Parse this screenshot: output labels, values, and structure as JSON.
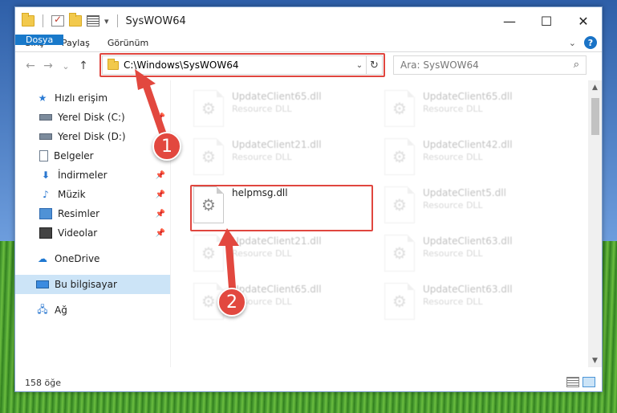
{
  "window": {
    "title": "SysWOW64",
    "controls": {
      "minimize": "—",
      "maximize": "☐",
      "close": "✕"
    }
  },
  "ribbon": {
    "tabs": [
      {
        "label": "Dosya",
        "active": true
      },
      {
        "label": "Giriş"
      },
      {
        "label": "Paylaş"
      },
      {
        "label": "Görünüm"
      }
    ],
    "expand_icon": "chevron-down-icon",
    "help_label": "?"
  },
  "nav_buttons": {
    "back": "←",
    "forward": "→",
    "recent": "⌄",
    "up": "↑"
  },
  "address": {
    "path": "C:\\Windows\\SysWOW64",
    "dropdown": "⌄",
    "refresh": "↻"
  },
  "search": {
    "placeholder": "Ara: SysWOW64"
  },
  "sidebar": {
    "items": [
      {
        "label": "Hızlı erişim",
        "icon": "star-icon"
      },
      {
        "label": "Yerel Disk (C:)",
        "icon": "drive-icon",
        "pinned": true
      },
      {
        "label": "Yerel Disk (D:)",
        "icon": "drive-icon"
      },
      {
        "label": "Belgeler",
        "icon": "documents-icon"
      },
      {
        "label": "İndirmeler",
        "icon": "download-icon",
        "pinned": true
      },
      {
        "label": "Müzik",
        "icon": "music-icon",
        "pinned": true
      },
      {
        "label": "Resimler",
        "icon": "pictures-icon",
        "pinned": true
      },
      {
        "label": "Videolar",
        "icon": "videos-icon",
        "pinned": true
      },
      {
        "label": "OneDrive",
        "icon": "cloud-icon"
      },
      {
        "label": "Bu bilgisayar",
        "icon": "computer-icon",
        "selected": true
      },
      {
        "label": "Ağ",
        "icon": "network-icon"
      }
    ]
  },
  "files": {
    "highlighted": {
      "name": "helpmsg.dll"
    },
    "left_column": [
      {
        "name": "UpdateClient65.dll",
        "type": "Resource DLL"
      },
      {
        "name": "UpdateClient21.dll",
        "type": "Resource DLL"
      },
      {
        "name": "UpdateClient21.dll",
        "type": "Resource DLL"
      },
      {
        "name": "UpdateClient65.dll",
        "type": "Resource DLL"
      }
    ],
    "right_column": [
      {
        "name": "UpdateClient65.dll",
        "type": "Resource DLL"
      },
      {
        "name": "UpdateClient42.dll",
        "type": "Resource DLL"
      },
      {
        "name": "UpdateClient5.dll",
        "type": "Resource DLL"
      },
      {
        "name": "UpdateClient63.dll",
        "type": "Resource DLL"
      },
      {
        "name": "UpdateClient63.dll",
        "type": "Resource DLL"
      }
    ]
  },
  "status": {
    "count": "158 öğe"
  },
  "annotations": {
    "step1": "1",
    "step2": "2",
    "accent": "#e2483f"
  }
}
